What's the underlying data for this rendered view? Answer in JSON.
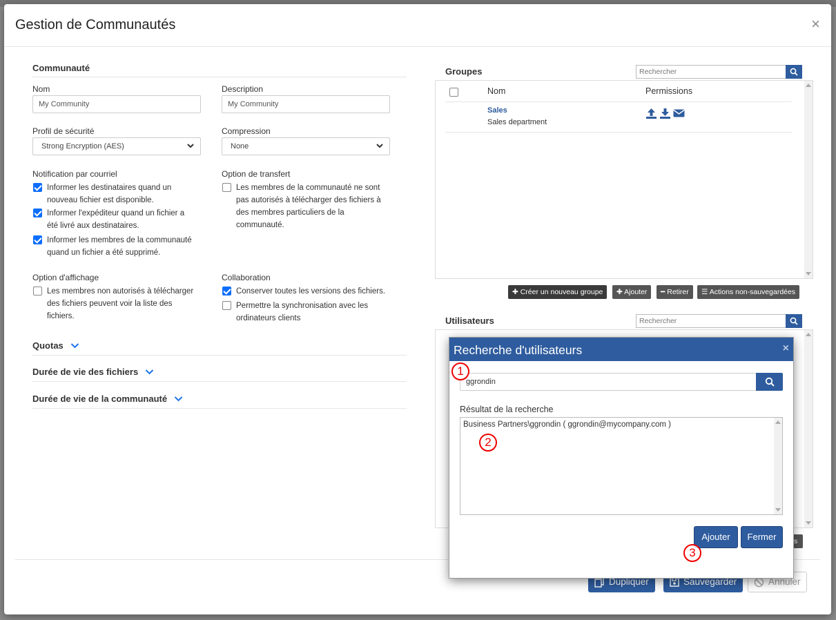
{
  "modal": {
    "title": "Gestion de Communautés",
    "close": "×"
  },
  "left": {
    "section_title": "Communauté",
    "nom": {
      "label": "Nom",
      "value": "My Community"
    },
    "description": {
      "label": "Description",
      "value": "My Community"
    },
    "profil": {
      "label": "Profil de sécurité",
      "value": "Strong Encryption (AES)"
    },
    "compression": {
      "label": "Compression",
      "value": "None"
    },
    "notification": {
      "label": "Notification par courriel",
      "items": [
        {
          "text_line1": "Informer les destinataires quand un",
          "text_line2": "nouveau fichier est disponible.",
          "checked": true
        },
        {
          "text_line1": "Informer l'expéditeur quand un fichier a",
          "text_line2": "été livré aux destinataires.",
          "checked": true
        },
        {
          "text_line1": "Informer les membres de la communauté",
          "text_line2": "quand un fichier a été supprimé.",
          "checked": true
        }
      ]
    },
    "transfert": {
      "label": "Option de transfert",
      "text_line1": "Les membres de la communauté ne sont",
      "text_line2": "pas autorisés à télécharger des fichiers à",
      "text_line3": "des membres particuliers de la",
      "text_line4": "communauté.",
      "checked": false
    },
    "affichage": {
      "label": "Option d'affichage",
      "text_line1": "Les membres non autorisés à télécharger",
      "text_line2": "des fichiers peuvent voir la liste des",
      "text_line3": "fichiers.",
      "checked": false
    },
    "collaboration": {
      "label": "Collaboration",
      "item1": {
        "text": "Conserver toutes les versions des fichiers.",
        "checked": true
      },
      "item2": {
        "text_line1": "Permettre la synchronisation avec les",
        "text_line2": "ordinateurs clients",
        "checked": false
      }
    },
    "quotas": "Quotas",
    "duree_fichiers": "Durée de vie des fichiers",
    "duree_communaute": "Durée de vie de la communauté"
  },
  "groupes": {
    "title": "Groupes",
    "search_placeholder": "Rechercher",
    "col_nom": "Nom",
    "col_permissions": "Permissions",
    "rows": [
      {
        "name": "Sales",
        "description": "Sales department",
        "permissions": [
          "upload-icon",
          "download-icon",
          "envelope-icon"
        ]
      }
    ],
    "buttons": {
      "create": "Créer un nouveau groupe",
      "add": "Ajouter",
      "remove": "Retirer",
      "unsaved": "Actions non-sauvegardées"
    }
  },
  "utilisateurs": {
    "title": "Utilisateurs",
    "search_placeholder": "Rechercher",
    "hidden_btn_tail": "s"
  },
  "footer": {
    "duplicate": "Dupliquer",
    "save": "Sauvegarder",
    "cancel": "Annuler"
  },
  "dialog": {
    "title": "Recherche d'utilisateurs",
    "close": "×",
    "search_value": "ggrondin",
    "result_label": "Résultat de la recherche",
    "result_item": "Business Partners\\ggrondin ( ggrondin@mycompany.com )",
    "add": "Ajouter",
    "close_btn": "Fermer",
    "markers": [
      "1",
      "2",
      "3"
    ]
  },
  "colors": {
    "primary": "#2e5c9e",
    "checkbox": "#0d6efd",
    "marker": "#e00000"
  }
}
